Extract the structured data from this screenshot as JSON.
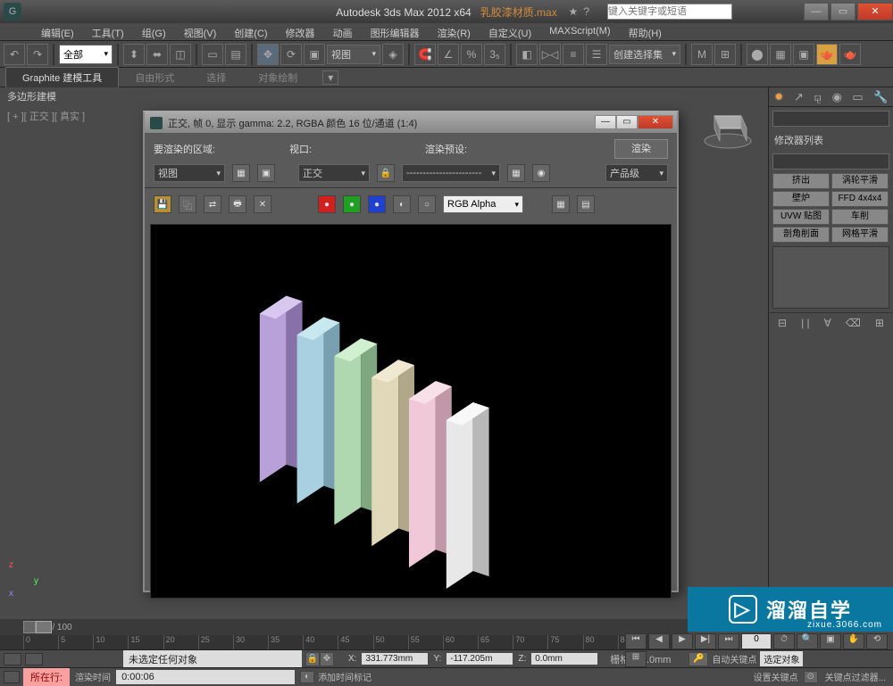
{
  "title_app": "Autodesk 3ds Max 2012 x64",
  "title_file": "乳胶漆材质.max",
  "search_placeholder": "键入关键字或短语",
  "menu": [
    "编辑(E)",
    "工具(T)",
    "组(G)",
    "视图(V)",
    "创建(C)",
    "修改器",
    "动画",
    "图形编辑器",
    "渲染(R)",
    "自定义(U)",
    "MAXScript(M)",
    "帮助(H)"
  ],
  "toolbar_selset": "全部",
  "toolbar_view": "视图",
  "toolbar_selmode": "创建选择集",
  "ribbon_tabs": [
    "Graphite 建模工具",
    "自由形式",
    "选择",
    "对象绘制"
  ],
  "ribbon_body": "多边形建模",
  "vp_label": "[ + ][ 正交 ][ 真实 ]",
  "render_title": "正交, 帧 0, 显示 gamma: 2.2, RGBA 颜色 16 位/通道 (1:4)",
  "render_row1": {
    "area": "要渲染的区域:",
    "viewport": "视口:",
    "preset": "渲染预设:",
    "btn": "渲染"
  },
  "render_row1_vals": {
    "area": "视图",
    "viewport": "正交",
    "preset": "-----------------------",
    "prod": "产品级"
  },
  "render_channel": "RGB Alpha",
  "rp_title": "修改器列表",
  "rp_buttons": [
    "挤出",
    "涡轮平滑",
    "壁炉",
    "FFD 4x4x4",
    "UVW 贴图",
    "车削",
    "剖角削面",
    "网格平滑"
  ],
  "timeline_range": "0 / 100",
  "status_sel": "未选定任何对象",
  "coords": {
    "x": "331.773mm",
    "y": "-117.205m",
    "z": "0.0mm"
  },
  "grid": "栅格 = 0.0mm",
  "autokey": "自动关键点",
  "selset_status": "选定对象",
  "macro_btn": "所在行:",
  "render_time_label": "渲染时间",
  "render_time": "0:00:06",
  "add_time_marker": "添加时间标记",
  "setkey": "设置关键点",
  "keyfilter": "关键点过滤器...",
  "watermark": "溜溜自学",
  "watermark_sub": "zixue.3066.com"
}
